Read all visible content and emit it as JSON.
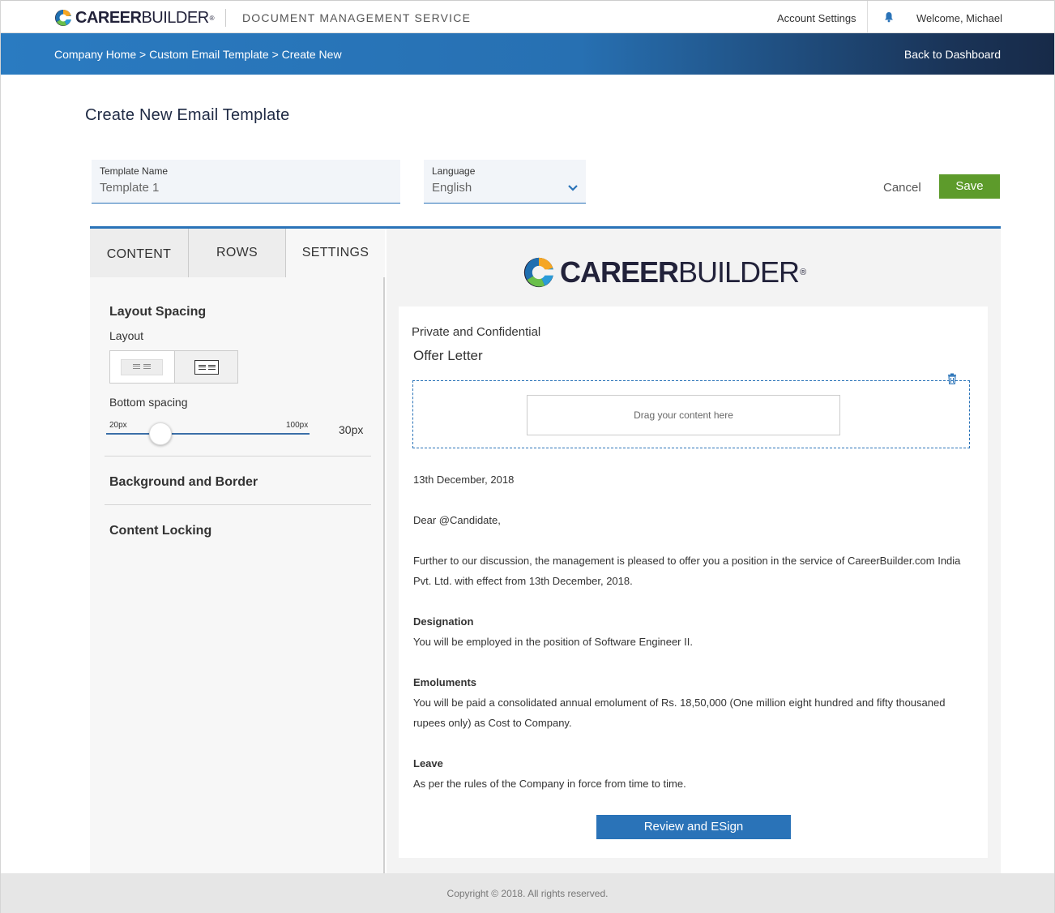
{
  "header": {
    "brand_bold": "CAREER",
    "brand_light": "BUILDER",
    "brand_reg": "®",
    "service": "DOCUMENT MANAGEMENT SERVICE",
    "account_settings": "Account Settings",
    "welcome": "Welcome, Michael"
  },
  "nav": {
    "breadcrumb": "Company Home > Custom Email Template > Create New",
    "back": "Back to Dashboard"
  },
  "page": {
    "title": "Create New Email Template"
  },
  "form": {
    "template_name_label": "Template Name",
    "template_name_value": "Template 1",
    "language_label": "Language",
    "language_value": "English",
    "cancel": "Cancel",
    "save": "Save"
  },
  "editor": {
    "tabs": [
      "CONTENT",
      "ROWS",
      "SETTINGS"
    ],
    "layout_spacing": "Layout Spacing",
    "layout": "Layout",
    "bottom_spacing": "Bottom spacing",
    "slider_min": "20px",
    "slider_max": "100px",
    "slider_value": "30px",
    "slider_fraction": 0.125,
    "background_border": "Background and Border",
    "content_locking": "Content Locking"
  },
  "preview": {
    "confidential": "Private and Confidential",
    "offer_letter": "Offer Letter",
    "drag_here": "Drag your content here",
    "date": "13th December, 2018",
    "salutation": "Dear @Candidate,",
    "intro": "Further to our discussion, the management is pleased to offer you a position in the service of CareerBuilder.com India Pvt. Ltd. with effect from 13th December, 2018.",
    "designation_title": "Designation",
    "designation_text": "You will be employed in the position of Software Engineer II.",
    "emoluments_title": "Emoluments",
    "emoluments_text": "You will be paid a consolidated annual emolument of Rs. 18,50,000 (One million eight hundred and fifty thousaned rupees only) as Cost to Company.",
    "leave_title": "Leave",
    "leave_text": "As per the rules of the Company in force from time to time.",
    "review_button": "Review and ESign"
  },
  "footer": {
    "copyright": "Copyright © 2018. All rights reserved."
  },
  "colors": {
    "accent": "#2a73b8",
    "save": "#5d9b2b",
    "brand_dark": "#22223a"
  },
  "icons": {
    "logo": "careerbuilder-logo-icon",
    "bell": "bell-icon",
    "chevron": "chevron-down-icon",
    "trash": "trash-icon"
  }
}
